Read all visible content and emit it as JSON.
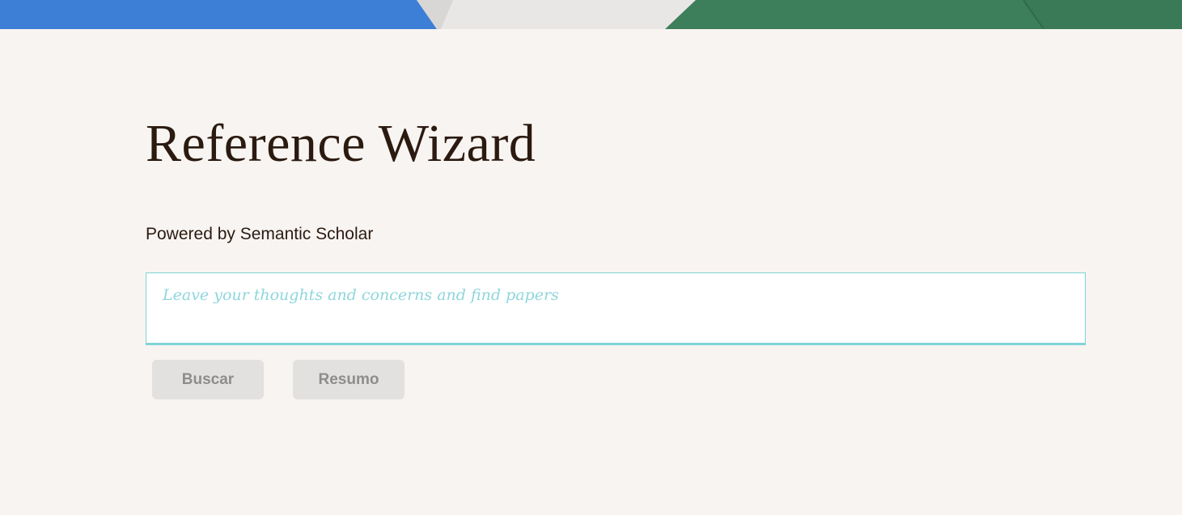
{
  "header": {
    "title": "Reference Wizard",
    "subtitle": "Powered by Semantic Scholar"
  },
  "search": {
    "placeholder": "Leave your thoughts and concerns and find papers",
    "value": ""
  },
  "actions": {
    "search_label": "Buscar",
    "summary_label": "Resumo"
  },
  "colors": {
    "background": "#f7f4f1",
    "title_text": "#2b1a10",
    "input_border": "#7fd4d6",
    "placeholder": "#8ed6dc",
    "button_bg": "#e2e1e0",
    "button_text": "#8f8d8b"
  }
}
